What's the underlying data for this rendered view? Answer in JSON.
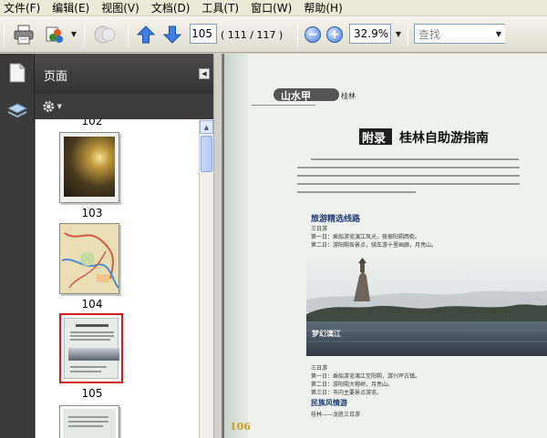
{
  "menu": [
    "文件(F)",
    "编辑(E)",
    "视图(V)",
    "文档(D)",
    "工具(T)",
    "窗口(W)",
    "帮助(H)"
  ],
  "toolbar": {
    "page_number": "105",
    "page_info": "( 111 / 117 )",
    "zoom": "32.9%",
    "search_placeholder": "查找"
  },
  "panel": {
    "title": "页面",
    "partial_label": "102",
    "thumbnails": [
      {
        "label": "103",
        "selected": false
      },
      {
        "label": "104",
        "selected": false
      },
      {
        "label": "105",
        "selected": true
      }
    ]
  },
  "page": {
    "series": "山水甲",
    "series_sub": "桂林",
    "appendix_tag": "附录",
    "heading": "桂林自助游指南",
    "section_route": "旅游精选线路",
    "section_route_sub": "三日游",
    "route_day1": "第一日：乘船游览漓江风光，夜宿阳朔西街。",
    "route_day2": "第二日：游阳朔各景点，骑车游十里画廊，月亮山。",
    "photo_caption": "梦幻漓江",
    "section_tour3": "三日游",
    "tour_day1": "第一日：乘船游览漓江至阳朔，游兴坪古镇。",
    "tour_day2": "第二日：游阳朔大榕树，月亮山。",
    "tour_day3": "第三日：市内主要景点游览。",
    "section_folk": "民族风情游",
    "folk_sub": "桂林——龙胜三日游",
    "page_number": "106"
  },
  "colors": {
    "accent_red": "#d42020",
    "heading_blue": "#1e3a6e",
    "panel_dark": "#3a3a3a"
  }
}
